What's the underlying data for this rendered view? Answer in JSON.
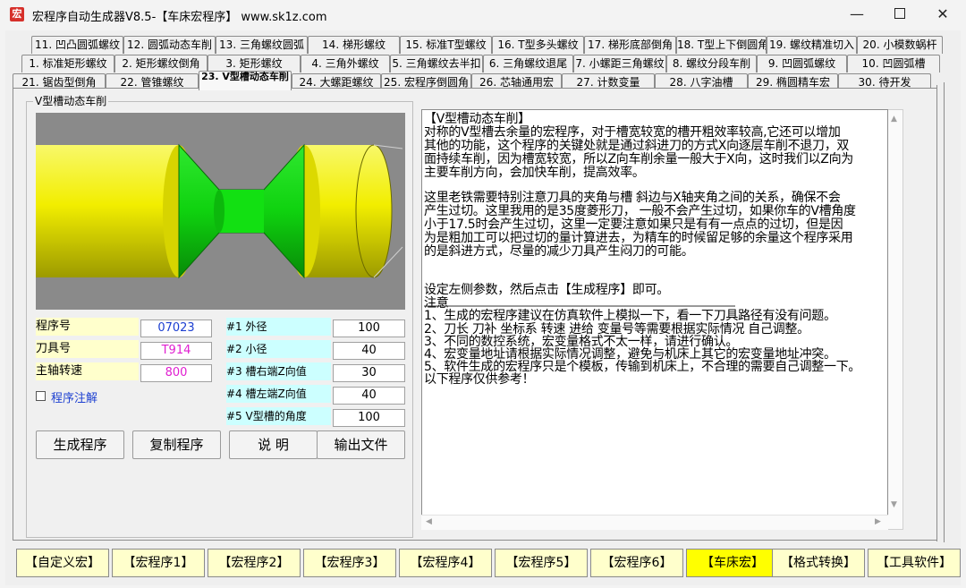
{
  "window": {
    "title": "宏程序自动生成器V8.5-【车床宏程序】  www.sk1z.com",
    "icon_text": "宏",
    "minimize": "—",
    "close": "✕"
  },
  "tabs": {
    "row_top": [
      "11. 凹凸圆弧螺纹",
      "12. 圆弧动态车削",
      "13. 三角螺纹圆弧",
      "14. 梯形螺纹",
      "15. 标准T型螺纹",
      "16. T型多头螺纹",
      "17. 梯形底部倒角",
      "18. T型上下倒圆角",
      "19. 螺纹精准切入",
      "20. 小模数蜗杆"
    ],
    "row_mid": [
      "1. 标准矩形螺纹",
      "2. 矩形螺纹倒角",
      "3. 矩形螺纹",
      "4. 三角外螺纹",
      "5. 三角螺纹去半扣",
      "6. 三角螺纹退尾",
      "7. 小螺距三角螺纹",
      "8. 螺纹分段车削",
      "9. 凹圆弧螺纹",
      "10. 凹圆弧槽"
    ],
    "row_bottom": [
      "21. 锯齿型倒角",
      "22. 管锥螺纹",
      "23. V型槽动态车削",
      "24. 大螺距螺纹",
      "25. 宏程序倒圆角",
      "26. 芯轴通用宏",
      "27. 计数变量",
      "28. 八字油槽",
      "29. 椭圆精车宏",
      "30. 待开发"
    ]
  },
  "group_title": "V型槽动态车削",
  "params_left": [
    {
      "label": "程序号",
      "value": "07023"
    },
    {
      "label": "刀具号",
      "value": "T914"
    },
    {
      "label": "主轴转速",
      "value": "800"
    }
  ],
  "params_right": [
    {
      "label": "#1 外径",
      "value": "100"
    },
    {
      "label": "#2 小径",
      "value": "40"
    },
    {
      "label": "#3 槽右端Z向值",
      "value": "30"
    },
    {
      "label": "#4 槽左端Z向值",
      "value": "40"
    },
    {
      "label": "#5 V型槽的角度",
      "value": "100"
    }
  ],
  "checkbox_label": "程序注解",
  "actions": [
    "生成程序",
    "复制程序",
    "说 明",
    "输出文件"
  ],
  "description": [
    "【V型槽动态车削】",
    "对称的V型槽去余量的宏程序，对于槽宽较宽的槽开粗效率较高,它还可以增加",
    "其他的功能，这个程序的关键处就是通过斜进刀的方式X向逐层车削不退刀，双",
    "面持续车削，因为槽宽较宽，所以Z向车削余量一般大于X向，这时我们以Z向为",
    "主要车削方向，会加快车削，提高效率。",
    "",
    "这里老铁需要特别注意刀具的夹角与槽  斜边与X轴夹角之间的关系，确保不会",
    "产生过切。这里我用的是35度菱形刀，  一般不会产生过切，如果你车的V槽角度",
    "  小于17.5时会产生过切，这里一定要注意如果只是有有一点点的过切，但是因",
    "为是粗加工可以把过切的量计算进去，为精车的时候留足够的余量这个程序采用",
    "的是斜进方式，尽量的减少刀具产生闷刀的可能。",
    "",
    "",
    "设定左侧参数，然后点击【生成程序】即可。",
    "                  注意",
    "1、生成的宏程序建议在仿真软件上模拟一下，看一下刀具路径有没有问题。",
    "2、刀长 刀补 坐标系 转速 进给 变量号等需要根据实际情况 自己调整。",
    "3、不同的数控系统，宏变量格式不太一样，请进行确认。",
    "4、宏变量地址请根据实际情况调整，避免与机床上其它的宏变量地址冲突。",
    "5、软件生成的宏程序只是个模板，传输到机床上，不合理的需要自己调整一下。",
    "以下程序仅供参考！"
  ],
  "bottom_buttons": [
    "【自定义宏】",
    "【宏程序1】",
    "【宏程序2】",
    "【宏程序3】",
    "【宏程序4】",
    "【宏程序5】",
    "【宏程序6】",
    "【车床宏】",
    "【格式转换】",
    "【工具软件】"
  ],
  "colors": {
    "part_yellow": "#f2ee00",
    "groove_green": "#0fd20f",
    "active_bottom": "#ffff00",
    "label_yellow": "#ffffcc",
    "label_cyan": "#ccffff"
  }
}
